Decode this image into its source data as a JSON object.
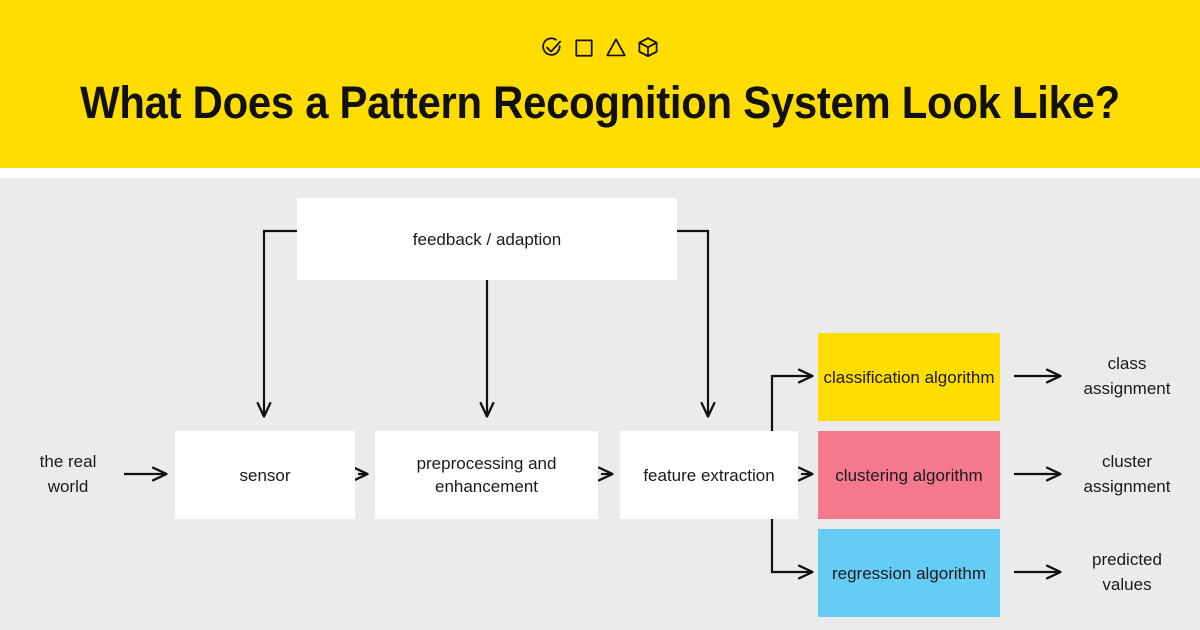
{
  "header": {
    "background_color": "#ffdd00",
    "title": "What Does a Pattern Recognition System Look Like?",
    "icons": [
      {
        "name": "check-circle-icon",
        "label": "check circle"
      },
      {
        "name": "square-icon",
        "label": "square"
      },
      {
        "name": "triangle-icon",
        "label": "triangle"
      },
      {
        "name": "cube-icon",
        "label": "cube"
      }
    ]
  },
  "diagram": {
    "background_color": "#ebebeb",
    "feedback": {
      "label": "feedback / adaption",
      "color": "#ffffff"
    },
    "input": {
      "label": "the real world"
    },
    "pipeline": [
      {
        "label": "sensor",
        "color": "#ffffff"
      },
      {
        "label": "preprocessing and enhancement",
        "color": "#ffffff"
      },
      {
        "label": "feature extraction",
        "color": "#ffffff"
      }
    ],
    "algorithms": [
      {
        "label": "classification algorithm",
        "color": "#ffdd00",
        "output": "class assignment"
      },
      {
        "label": "clustering algorithm",
        "color": "#f4798f",
        "output": "cluster assignment"
      },
      {
        "label": "regression algorithm",
        "color": "#64ccf5",
        "output": "predicted values"
      }
    ]
  }
}
